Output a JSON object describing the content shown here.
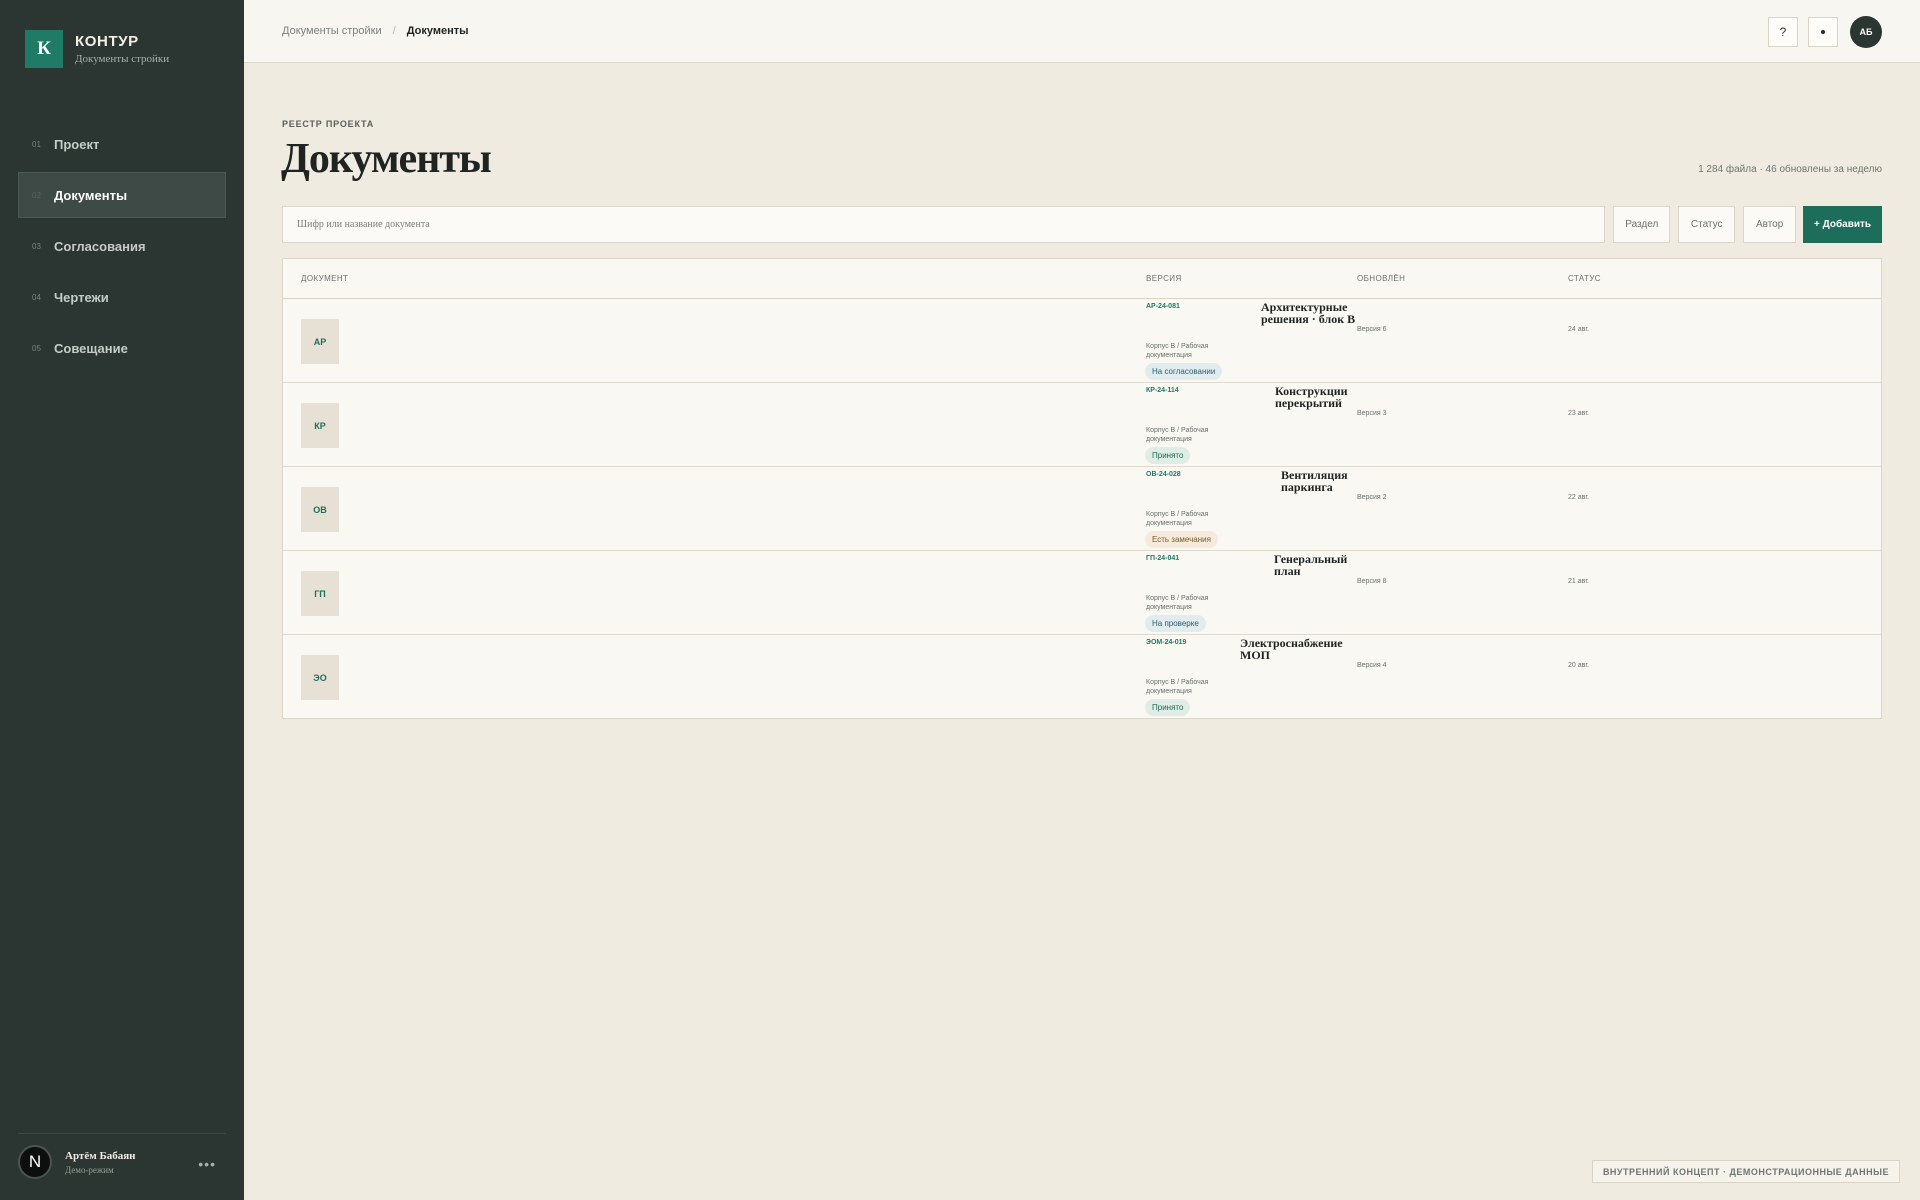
{
  "brand": {
    "logo_letter": "К",
    "name": "КОНТУР",
    "subtitle": "Документы стройки"
  },
  "nav": [
    {
      "num": "01",
      "label": "Проект"
    },
    {
      "num": "02",
      "label": "Документы"
    },
    {
      "num": "03",
      "label": "Согласования"
    },
    {
      "num": "04",
      "label": "Чертежи"
    },
    {
      "num": "05",
      "label": "Совещание"
    }
  ],
  "user": {
    "avatar_letter": "N",
    "name": "Артём Бабаян",
    "mode": "Демо-режим",
    "menu": "•••"
  },
  "breadcrumb": {
    "parent": "Документы стройки",
    "sep": "/",
    "current": "Документы"
  },
  "topbar": {
    "help": "?",
    "avatar": "АБ"
  },
  "header": {
    "eyebrow": "РЕЕСТР ПРОЕКТА",
    "title": "Документы",
    "stats": "1 284 файла · 46 обновлены за неделю"
  },
  "toolbar": {
    "search_placeholder": "Шифр или название документа",
    "filter_section": "Раздел",
    "filter_status": "Статус",
    "filter_author": "Автор",
    "add_label": "+ Добавить"
  },
  "table": {
    "headers": {
      "document": "ДОКУМЕНТ",
      "version": "ВЕРСИЯ",
      "updated": "ОБНОВЛЁН",
      "status": "СТАТУС"
    },
    "rows": [
      {
        "section": "АР",
        "code": "АР-24-081",
        "title": "Архитектурные решения · блок В",
        "path": "Корпус В / Рабочая документация",
        "status": "На согласовании",
        "version": "Версия 6",
        "date": "24 авг."
      },
      {
        "section": "КР",
        "code": "КР-24-114",
        "title": "Конструкции перекрытий",
        "path": "Корпус В / Рабочая документация",
        "status": "Принято",
        "version": "Версия 3",
        "date": "23 авг."
      },
      {
        "section": "ОВ",
        "code": "ОВ-24-028",
        "title": "Вентиляция паркинга",
        "path": "Корпус В / Рабочая документация",
        "status": "Есть замечания",
        "version": "Версия 2",
        "date": "22 авг."
      },
      {
        "section": "ГП",
        "code": "ГП-24-041",
        "title": "Генеральный план",
        "path": "Корпус В / Рабочая документация",
        "status": "На проверке",
        "version": "Версия 8",
        "date": "21 авг."
      },
      {
        "section": "ЭО",
        "code": "ЭОМ-24-019",
        "title": "Электроснабжение МОП",
        "path": "Корпус В / Рабочая документация",
        "status": "Принято",
        "version": "Версия 4",
        "date": "20 авг."
      }
    ]
  },
  "footer_note": "ВНУТРЕННИЙ КОНЦЕПТ · ДЕМОНСТРАЦИОННЫЕ ДАННЫЕ",
  "colors": {
    "sidebar": "#2b3531",
    "accent": "#1d6d5b",
    "background": "#efebe1"
  }
}
